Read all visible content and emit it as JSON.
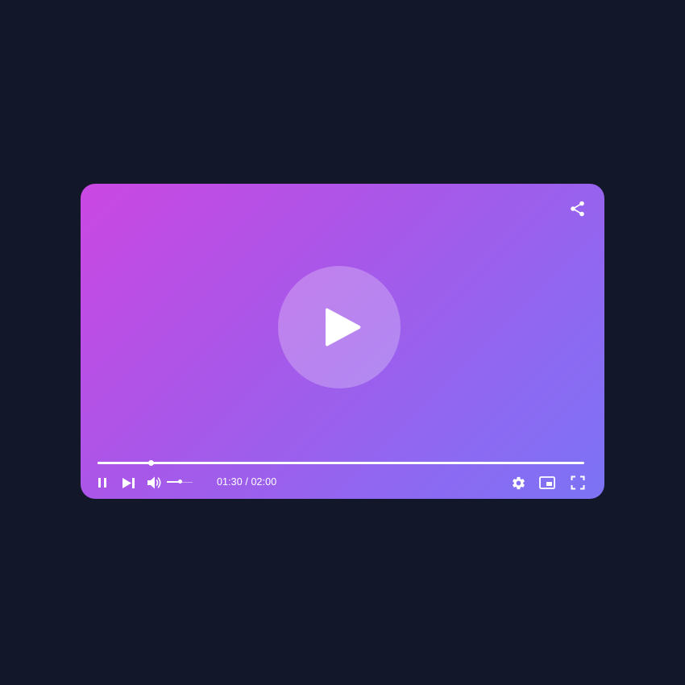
{
  "player": {
    "current_time": "01:30",
    "time_separator": " / ",
    "duration": "02:00",
    "progress_fraction": 0.11,
    "volume_fraction": 0.5,
    "colors": {
      "background": "#121829",
      "gradient_start": "#cb47e3",
      "gradient_end": "#7c73f5",
      "controls": "#ffffff"
    }
  },
  "icons": {
    "share": "share-icon",
    "big_play": "play-icon",
    "pause": "pause-icon",
    "next": "skip-next-icon",
    "volume": "volume-icon",
    "settings": "gear-icon",
    "miniplayer": "picture-in-picture-icon",
    "fullscreen": "fullscreen-icon"
  }
}
